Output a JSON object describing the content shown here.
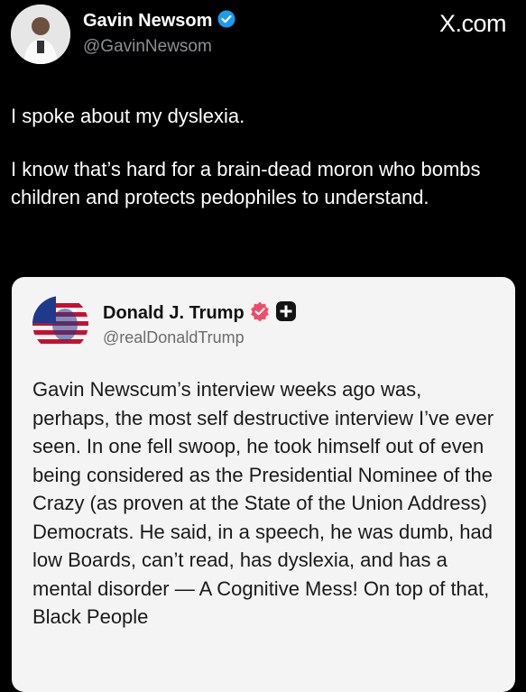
{
  "tweet": {
    "author_name": "Gavin Newsom",
    "handle": "@GavinNewsom",
    "brand": "X.com",
    "verified_color": "#1d9bf0",
    "paragraphs": [
      "I spoke about my dyslexia.",
      "I know that’s hard for a brain-dead moron who bombs children and protects pedophiles to understand."
    ]
  },
  "quote": {
    "author_name": "Donald J. Trump",
    "handle": "@realDonaldTrump",
    "verified_color": "#ee4c6a",
    "plus_badge_icon": "plus-badge-icon",
    "text": "Gavin Newscum’s interview weeks ago was, perhaps, the most self destructive interview I’ve ever seen. In one fell swoop, he took himself out of even being considered as the Presidential Nominee of the Crazy (as proven at the State of the Union Address) Democrats. He said, in a speech, he was dumb, had low Boards, can’t read, has dyslexia, and has a mental disorder — A Cognitive Mess! On top of that, Black People"
  }
}
